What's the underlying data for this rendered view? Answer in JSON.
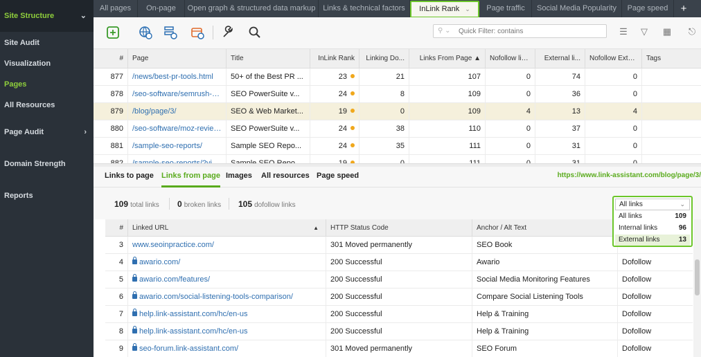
{
  "sidebar": {
    "items": [
      {
        "label": "Site Structure"
      },
      {
        "label": "Site Audit"
      },
      {
        "label": "Visualization"
      },
      {
        "label": "Pages"
      },
      {
        "label": "All Resources"
      },
      {
        "label": "Page Audit"
      },
      {
        "label": "Domain Strength"
      },
      {
        "label": "Reports"
      }
    ]
  },
  "tabs": [
    {
      "label": "All pages"
    },
    {
      "label": "On-page"
    },
    {
      "label": "Open graph & structured data markup"
    },
    {
      "label": "Links & technical factors"
    },
    {
      "label": "InLink Rank"
    },
    {
      "label": "Page traffic"
    },
    {
      "label": "Social Media Popularity"
    },
    {
      "label": "Page speed"
    }
  ],
  "add_tab_label": "+",
  "filter": {
    "placeholder": "Quick Filter: contains"
  },
  "grid": {
    "headers": [
      "#",
      "Page",
      "Title",
      "InLink Rank",
      "Linking Do...",
      "Links From Page",
      "Nofollow lin...",
      "External li...",
      "Nofollow Exte...",
      "Tags"
    ],
    "sort_indicator": "▲",
    "rows": [
      {
        "n": "877",
        "page": "/news/best-pr-tools.html",
        "title": "50+ of the Best PR ...",
        "rank": "23",
        "ld": "21",
        "lfp": "107",
        "nf": "0",
        "ext": "74",
        "nfe": "0"
      },
      {
        "n": "878",
        "page": "/seo-software/semrush-revie...",
        "title": "SEO PowerSuite v...",
        "rank": "24",
        "ld": "8",
        "lfp": "109",
        "nf": "0",
        "ext": "36",
        "nfe": "0"
      },
      {
        "n": "879",
        "page": "/blog/page/3/",
        "title": "SEO & Web Market...",
        "rank": "19",
        "ld": "0",
        "lfp": "109",
        "nf": "4",
        "ext": "13",
        "nfe": "4"
      },
      {
        "n": "880",
        "page": "/seo-software/moz-review....",
        "title": "SEO PowerSuite v...",
        "rank": "24",
        "ld": "38",
        "lfp": "110",
        "nf": "0",
        "ext": "37",
        "nfe": "0"
      },
      {
        "n": "881",
        "page": "/sample-seo-reports/",
        "title": "Sample SEO Repo...",
        "rank": "24",
        "ld": "35",
        "lfp": "111",
        "nf": "0",
        "ext": "31",
        "nfe": "0"
      },
      {
        "n": "882",
        "page": "/sample-seo-reports/?view=s...",
        "title": "Sample SEO Repo...",
        "rank": "19",
        "ld": "0",
        "lfp": "111",
        "nf": "0",
        "ext": "31",
        "nfe": "0"
      }
    ]
  },
  "subtabs": [
    "Links to page",
    "Links from page",
    "Images",
    "All resources",
    "Page speed"
  ],
  "page_url": "https://www.link-assistant.com/blog/page/3/",
  "stats": [
    {
      "num": "109",
      "label": "total links"
    },
    {
      "num": "0",
      "label": "broken links"
    },
    {
      "num": "105",
      "label": "dofollow links"
    }
  ],
  "dropdown": {
    "selected": "All links",
    "options": [
      {
        "label": "All links",
        "count": "109"
      },
      {
        "label": "Internal links",
        "count": "96"
      },
      {
        "label": "External links",
        "count": "13"
      }
    ]
  },
  "links": {
    "headers": [
      "#",
      "Linked URL",
      "HTTP Status Code",
      "Anchor / Alt Text",
      ""
    ],
    "sort_indicator": "▲",
    "rows": [
      {
        "n": "3",
        "url": "www.seoinpractice.com/",
        "secure": false,
        "status": "301 Moved permanently",
        "anchor": "SEO Book",
        "rel": "Dofollow"
      },
      {
        "n": "4",
        "url": "awario.com/",
        "secure": true,
        "status": "200 Successful",
        "anchor": "Awario",
        "rel": "Dofollow"
      },
      {
        "n": "5",
        "url": "awario.com/features/",
        "secure": true,
        "status": "200 Successful",
        "anchor": "Social Media Monitoring Features",
        "rel": "Dofollow"
      },
      {
        "n": "6",
        "url": "awario.com/social-listening-tools-comparison/",
        "secure": true,
        "status": "200 Successful",
        "anchor": "Compare Social Listening Tools",
        "rel": "Dofollow"
      },
      {
        "n": "7",
        "url": "help.link-assistant.com/hc/en-us",
        "secure": true,
        "status": "200 Successful",
        "anchor": "Help & Training",
        "rel": "Dofollow"
      },
      {
        "n": "8",
        "url": "help.link-assistant.com/hc/en-us",
        "secure": true,
        "status": "200 Successful",
        "anchor": "Help & Training",
        "rel": "Dofollow"
      },
      {
        "n": "9",
        "url": "seo-forum.link-assistant.com/",
        "secure": true,
        "status": "301 Moved permanently",
        "anchor": "SEO Forum",
        "rel": "Dofollow"
      }
    ]
  },
  "colors": {
    "accent": "#6cc62a",
    "sidebar_bg": "#2a3139",
    "tabs_bg": "#3a424b",
    "selected_row": "#f5f0dc",
    "link": "#2f6fb0",
    "rank_dot": "#f0a81c"
  },
  "icons": [
    "add-icon",
    "globe-refresh-icon",
    "rescan-icon",
    "update-icon",
    "tools-icon",
    "search-icon",
    "list-icon",
    "filter-icon",
    "grid-icon",
    "export-icon"
  ]
}
